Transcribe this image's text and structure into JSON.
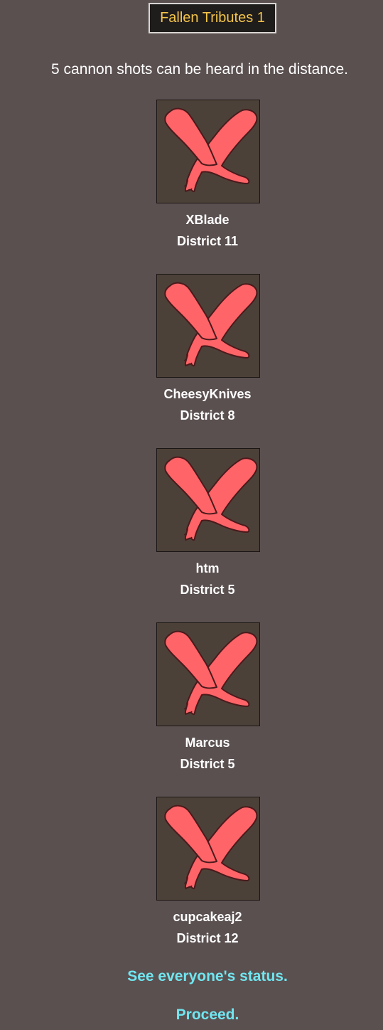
{
  "title": "Fallen Tributes 1",
  "announcement": "5 cannon shots can be heard in the distance.",
  "tributes": [
    {
      "name": "XBlade",
      "district": "District 11",
      "icon": "red-x-icon"
    },
    {
      "name": "CheesyKnives",
      "district": "District 8",
      "icon": "red-x-icon"
    },
    {
      "name": "htm",
      "district": "District 5",
      "icon": "red-x-icon"
    },
    {
      "name": "Marcus",
      "district": "District 5",
      "icon": "red-x-icon"
    },
    {
      "name": "cupcakeaj2",
      "district": "District 12",
      "icon": "red-x-icon"
    }
  ],
  "links": {
    "status": "See everyone's status.",
    "proceed": "Proceed."
  },
  "colors": {
    "background": "#5b5050",
    "title_text": "#f3c44a",
    "title_box": "#1f1c1c",
    "portrait_bg": "#4c4138",
    "x_fill": "#ff6468",
    "x_outline": "#4a1a1c",
    "link": "#6fe6f0"
  }
}
